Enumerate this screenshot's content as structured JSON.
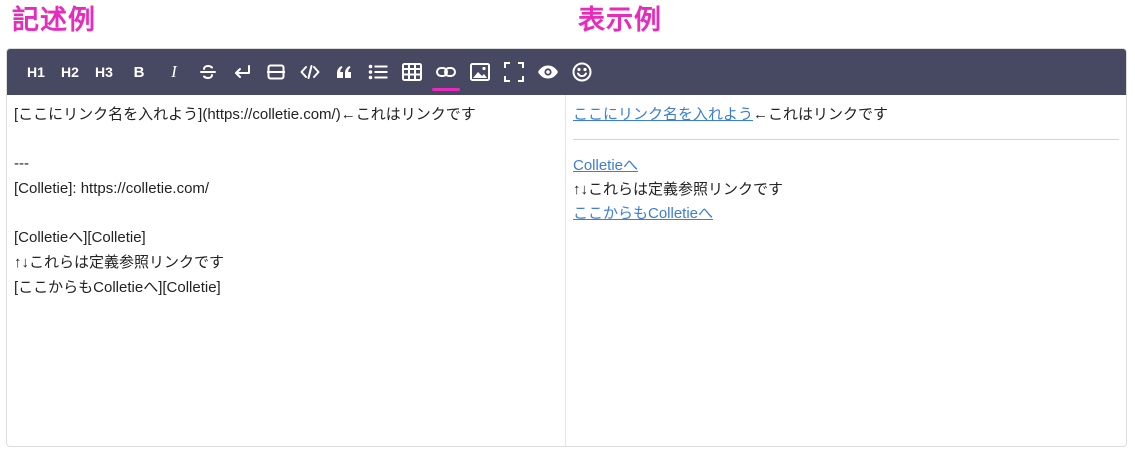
{
  "headings": {
    "left": "記述例",
    "right": "表示例"
  },
  "colors": {
    "heading": "#e62bbd",
    "toolbar_bg": "#474962",
    "active_underline": "#e62bbd",
    "link": "#3b7dd8"
  },
  "toolbar": {
    "h1": "H1",
    "h2": "H2",
    "h3": "H3",
    "bold": "B",
    "italic": "I",
    "icons": [
      "strikethrough-icon",
      "line-break-icon",
      "horizontal-rule-icon",
      "code-icon",
      "quote-icon",
      "bullet-list-icon",
      "table-icon",
      "link-icon",
      "image-icon",
      "fullscreen-icon",
      "preview-eye-icon",
      "emoji-icon"
    ],
    "active": "link-icon"
  },
  "source": {
    "lines": [
      "[ここにリンク名を入れよう](https://colletie.com/)←これはリンクです",
      "",
      "---",
      "[Colletie]: https://colletie.com/",
      "",
      "[Colletieへ][Colletie]",
      "↑↓これらは定義参照リンクです",
      "[ここからもColletieへ][Colletie]"
    ]
  },
  "preview": {
    "link1": "ここにリンク名を入れよう",
    "after_link1": "←これはリンクです",
    "link2": "Colletieへ",
    "note": "↑↓これらは定義参照リンクです",
    "link3": "ここからもColletieへ"
  }
}
